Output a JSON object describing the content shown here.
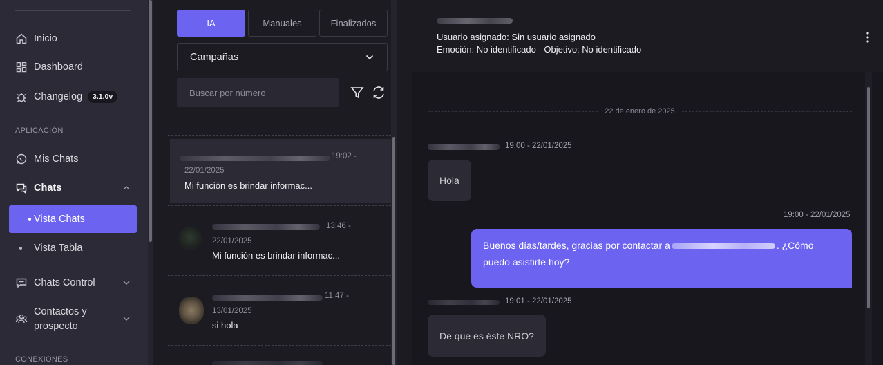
{
  "sidebar": {
    "items": [
      {
        "label": "Inicio"
      },
      {
        "label": "Dashboard"
      },
      {
        "label": "Changelog",
        "badge": "3.1.0v"
      }
    ],
    "section_app": "APLICACIÓN",
    "app_items": [
      {
        "label": "Mis Chats"
      },
      {
        "label": "Chats"
      },
      {
        "label": "Vista Chats"
      },
      {
        "label": "Vista Tabla"
      },
      {
        "label": "Chats Control"
      },
      {
        "label": "Contactos y prospecto"
      }
    ],
    "section_conn": "CONEXIONES"
  },
  "list": {
    "tabs": [
      "IA",
      "Manuales",
      "Finalizados"
    ],
    "campaign_select": "Campañas",
    "search_placeholder": "Buscar por número",
    "items": [
      {
        "time": "19:02 -",
        "date": "22/01/2025",
        "message": "Mi función es brindar informac..."
      },
      {
        "time": "13:46 -",
        "date": "22/01/2025",
        "message": "Mi función es brindar informac..."
      },
      {
        "time": "11:47 -",
        "date": "13/01/2025",
        "message": "si hola"
      }
    ]
  },
  "conversation": {
    "assigned": "Usuario asignado: Sin usuario asignado",
    "emotion": "Emoción: No identificado - Objetivo: No identificado",
    "date_separator": "22 de enero de 2025",
    "messages": [
      {
        "meta": "19:00 - 22/01/2025",
        "text": "Hola"
      },
      {
        "meta": "19:00 - 22/01/2025",
        "text_before": "Buenos días/tardes, gracias por contactar a",
        "text_after": ". ¿Cómo puedo asistirte hoy?"
      },
      {
        "meta": "19:01 - 22/01/2025",
        "text": "De que es éste NRO?"
      }
    ]
  },
  "colors": {
    "accent": "#6c63f0",
    "sidebar_bg": "#2b2a36",
    "main_bg": "#1c1b22"
  }
}
